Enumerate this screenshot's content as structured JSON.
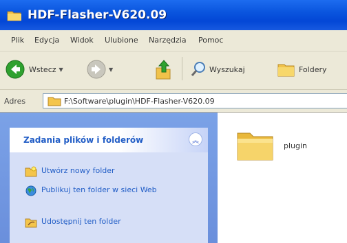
{
  "window": {
    "title": "HDF-Flasher-V620.09"
  },
  "menu": {
    "items": [
      "Plik",
      "Edycja",
      "Widok",
      "Ulubione",
      "Narzędzia",
      "Pomoc"
    ]
  },
  "toolbar": {
    "back_label": "Wstecz",
    "search_label": "Wyszukaj",
    "folders_label": "Foldery"
  },
  "address": {
    "label": "Adres",
    "path": "F:\\Software\\plugin\\HDF-Flasher-V620.09"
  },
  "taskpane": {
    "title": "Zadania plików i folderów",
    "tasks": [
      {
        "label": "Utwórz nowy folder",
        "icon": "new-folder-icon"
      },
      {
        "label": "Publikuj ten folder w sieci Web",
        "icon": "globe-icon"
      },
      {
        "label": "Udostępnij ten folder",
        "icon": "share-folder-icon"
      }
    ]
  },
  "files": [
    {
      "name": "plugin",
      "icon": "folder-icon"
    }
  ]
}
